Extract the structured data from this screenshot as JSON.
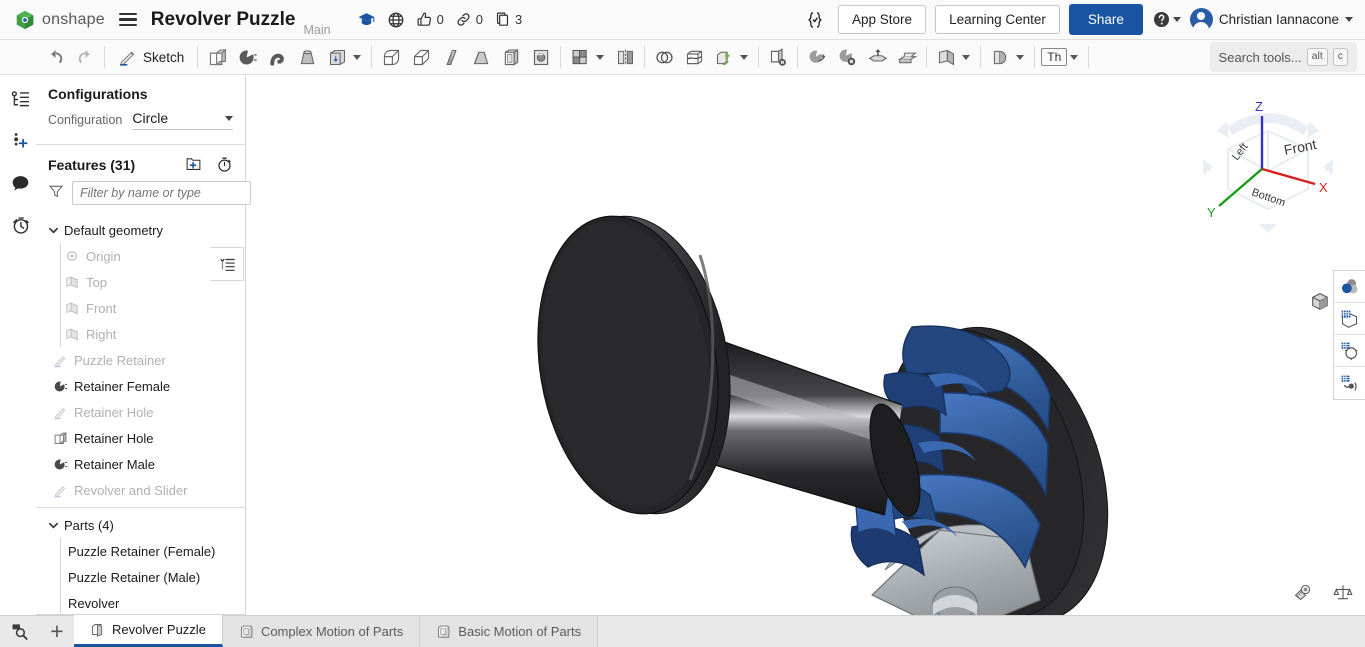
{
  "header": {
    "logo_text": "onshape",
    "logo_icon": "onshape-logo-icon",
    "menu_icon": "hamburger-menu-icon",
    "doc_title": "Revolver Puzzle",
    "branch": "Main",
    "icons": [
      {
        "name": "learning-cap-icon",
        "count": ""
      },
      {
        "name": "globe-icon",
        "count": ""
      },
      {
        "name": "thumbs-up-icon",
        "count": "0"
      },
      {
        "name": "link-icon",
        "count": "0"
      },
      {
        "name": "copy-icon",
        "count": "3"
      }
    ],
    "fs_icon": "feature-script-icon",
    "app_store_label": "App Store",
    "learning_center_label": "Learning Center",
    "share_label": "Share",
    "help_icon": "help-circle-icon",
    "user_name": "Christian Iannacone",
    "avatar_name": "user-avatar"
  },
  "toolbar": {
    "undo_icon": "undo-icon",
    "redo_icon": "redo-icon",
    "sketch_label": "Sketch",
    "sketch_icon": "sketch-pencil-icon",
    "tools": [
      "extrude-icon",
      "revolve-icon",
      "sweep-icon",
      "loft-icon",
      "thicken-icon",
      "fillet-icon",
      "chamfer-icon",
      "rib-icon",
      "draft-icon",
      "shell-icon",
      "hole-icon",
      "pattern-icon",
      "mirror-icon",
      "boolean-icon",
      "split-icon",
      "transform-icon",
      "delete-face-icon",
      "move-face-icon",
      "delete-part-icon",
      "import-derived-icon",
      "enclose-icon",
      "plane-icon",
      "sheet-metal-icon"
    ],
    "thickness_label": "Th",
    "search_placeholder": "Search tools...",
    "kbd_alt": "alt",
    "kbd_c": "c"
  },
  "left_rail": [
    {
      "name": "feature-tree-icon"
    },
    {
      "name": "add-feature-icon"
    },
    {
      "name": "comments-icon"
    },
    {
      "name": "history-icon"
    }
  ],
  "panel": {
    "configurations_title": "Configurations",
    "configuration_label": "Configuration",
    "configuration_value": "Circle",
    "features_title": "Features (31)",
    "new_folder_icon": "new-folder-icon",
    "timer_icon": "feature-timer-icon",
    "filter_icon": "filter-funnel-icon",
    "filter_placeholder": "Filter by name or type",
    "rollback_icon": "rollback-bar-icon",
    "tree": [
      {
        "label": "Default geometry",
        "icon": "folder-icon",
        "indent": 0,
        "dim": false,
        "bold": false,
        "expand": "down"
      },
      {
        "label": "Origin",
        "icon": "origin-icon",
        "indent": 1,
        "dim": true,
        "bold": false,
        "expand": ""
      },
      {
        "label": "Top",
        "icon": "plane-icon",
        "indent": 1,
        "dim": true,
        "bold": false,
        "expand": ""
      },
      {
        "label": "Front",
        "icon": "plane-icon",
        "indent": 1,
        "dim": true,
        "bold": false,
        "expand": ""
      },
      {
        "label": "Right",
        "icon": "plane-icon",
        "indent": 1,
        "dim": true,
        "bold": false,
        "expand": ""
      },
      {
        "label": "Puzzle Retainer",
        "icon": "sketch-icon",
        "indent": 0,
        "dim": true,
        "bold": false,
        "expand": ""
      },
      {
        "label": "Retainer Female",
        "icon": "revolve-icon",
        "indent": 0,
        "dim": false,
        "bold": false,
        "expand": ""
      },
      {
        "label": "Retainer Hole",
        "icon": "sketch-icon",
        "indent": 0,
        "dim": true,
        "bold": false,
        "expand": ""
      },
      {
        "label": "Retainer Hole",
        "icon": "extrude-icon",
        "indent": 0,
        "dim": false,
        "bold": false,
        "expand": ""
      },
      {
        "label": "Retainer Male",
        "icon": "revolve-icon",
        "indent": 0,
        "dim": false,
        "bold": false,
        "expand": ""
      },
      {
        "label": "Revolver and Slider",
        "icon": "sketch-icon",
        "indent": 0,
        "dim": true,
        "bold": false,
        "expand": ""
      }
    ],
    "parts_title": "Parts (4)",
    "parts": [
      {
        "label": "Puzzle Retainer (Female)"
      },
      {
        "label": "Puzzle Retainer (Male)"
      },
      {
        "label": "Revolver"
      }
    ]
  },
  "viewport": {
    "view_cube": {
      "front_label": "Front",
      "left_label": "Left",
      "bottom_label": "Bottom",
      "axis_z": "Z",
      "axis_x": "X",
      "axis_y": "Y",
      "color_z": "#3333cc",
      "color_x": "#d42020",
      "color_y": "#1a9c1a"
    },
    "display_style_icon": "display-style-cube-icon",
    "right_tools": [
      {
        "name": "appearance-icon"
      },
      {
        "name": "display-grid-icon"
      },
      {
        "name": "render-icon"
      },
      {
        "name": "simulate-icon"
      }
    ],
    "measure_icon": "measure-tape-icon",
    "mass-properties_icon": "mass-properties-scale-icon",
    "model_colors": {
      "body_dark": "#2b2b2d",
      "body_dark_light": "#4a4a4c",
      "revolver_blue": "#3a69b2",
      "revolver_blue_dark": "#1d3a71",
      "slider_gray": "#a9adb1",
      "slider_gray_light": "#c9ced2"
    }
  },
  "tabbar": {
    "search_icon": "tab-search-icon",
    "add_icon": "add-tab-icon",
    "tabs": [
      {
        "label": "Revolver Puzzle",
        "icon": "part-studio-icon",
        "active": true
      },
      {
        "label": "Complex Motion of Parts",
        "icon": "assembly-icon",
        "active": false
      },
      {
        "label": "Basic Motion of Parts",
        "icon": "assembly-icon",
        "active": false
      }
    ]
  }
}
